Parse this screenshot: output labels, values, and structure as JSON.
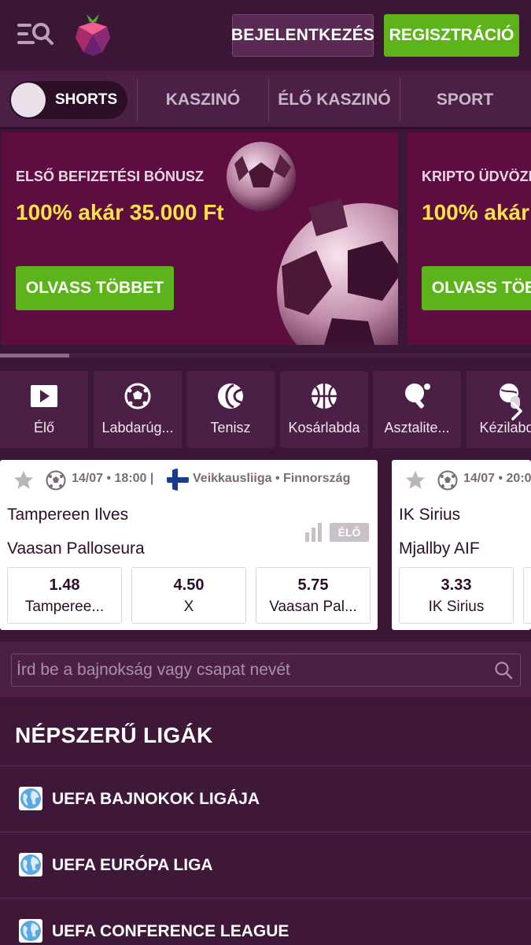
{
  "header": {
    "login_label": "BEJELENTKEZÉS",
    "register_label": "REGISZTRÁCIÓ"
  },
  "nav": {
    "shorts_label": "SHORTS",
    "items": [
      "KASZINÓ",
      "ÉLŐ KASZINÓ",
      "SPORT"
    ]
  },
  "promos": [
    {
      "eyebrow": "ELSŐ BEFIZETÉSI BÓNUSZ",
      "title": "100% akár 35.000 Ft",
      "button": "OLVASS TÖBBET"
    },
    {
      "eyebrow": "KRIPTO ÜDVÖZLŐ",
      "title": "100% akár",
      "button": "OLVASS TÖBBET"
    }
  ],
  "slider_progress": 0.13,
  "sports": [
    {
      "label": "Élő",
      "icon": "play-icon"
    },
    {
      "label": "Labdarúg...",
      "icon": "soccer-ball-icon"
    },
    {
      "label": "Tenisz",
      "icon": "tennis-ball-icon"
    },
    {
      "label": "Kosárlabda",
      "icon": "basketball-icon"
    },
    {
      "label": "Asztalite...",
      "icon": "table-tennis-icon"
    },
    {
      "label": "Kézilabda",
      "icon": "handball-icon"
    }
  ],
  "matches": [
    {
      "time": "14/07 • 18:00 |",
      "league": "Veikkausliiga • Finnország",
      "home": "Tampereen Ilves",
      "away": "Vaasan Palloseura",
      "live_badge": "ÉLŐ",
      "odds": [
        {
          "value": "1.48",
          "label": "Tamperee..."
        },
        {
          "value": "4.50",
          "label": "X"
        },
        {
          "value": "5.75",
          "label": "Vaasan Pal..."
        }
      ]
    },
    {
      "time": "14/07 • 20:0",
      "league": "",
      "home": "IK Sirius",
      "away": "Mjallby AIF",
      "live_badge": "",
      "odds": [
        {
          "value": "3.33",
          "label": "IK Sirius"
        }
      ]
    }
  ],
  "search": {
    "placeholder": "Írd be a bajnokság vagy csapat nevét"
  },
  "popular_leagues": {
    "title": "NÉPSZERŰ LIGÁK",
    "items": [
      "UEFA BAJNOKOK LIGÁJA",
      "UEFA EURÓPA LIGA",
      "UEFA CONFERENCE LEAGUE"
    ]
  },
  "colors": {
    "background": "#3b1637",
    "panel": "#4c1f47",
    "accent_green": "#5cb41a",
    "promo_bg": "#5d0d3f",
    "promo_highlight": "#ffe14a"
  }
}
